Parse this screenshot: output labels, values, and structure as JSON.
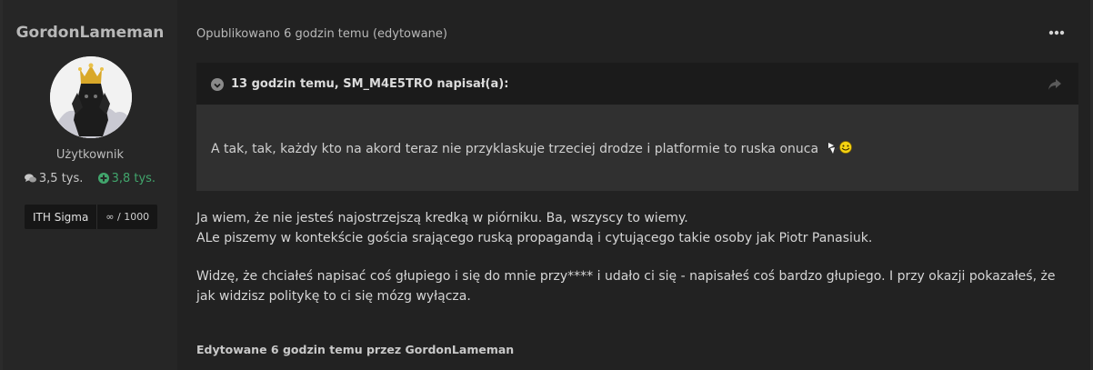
{
  "author": {
    "name": "GordonLameman",
    "rank": "Użytkownik",
    "posts_count": "3,5 tys.",
    "reputation": "3,8 tys.",
    "badge_title": "ITH Sigma",
    "badge_value": "∞ / 1000"
  },
  "post": {
    "meta": "Opublikowano 6 godzin temu (edytowane)",
    "quote": {
      "citation": "13 godzin temu, SM_M4E5TRO napisał(a):",
      "text": "A tak, tak, każdy kto na akord teraz nie przyklaskuje trzeciej drodze i platformie to ruska onuca"
    },
    "paragraphs": [
      {
        "line1": "Ja wiem, że nie jesteś najostrzejszą kredką w piórniku. Ba, wszyscy to wiemy.",
        "line2": "ALe piszemy w kontekście gościa srającego ruską propagandą i cytującego takie osoby jak Piotr Panasiuk."
      },
      {
        "line1": "Widzę, że chciałeś napisać coś głupiego i się do mnie przy**** i udało ci się - napisałeś coś bardzo głupiego. I przy okazji pokazałeś, że jak widzisz politykę to ci się mózg wyłącza."
      }
    ],
    "edited_note": "Edytowane 6 godzin temu przez GordonLameman"
  },
  "icons": {
    "posts": "comments-icon",
    "reputation": "plus-circle-icon",
    "more": "ellipsis-icon",
    "quote_toggle": "chevron-down-circle-icon",
    "share": "share-icon",
    "emote": "emoticon-icon"
  },
  "colors": {
    "background": "#222222",
    "sidebar": "#262626",
    "quote_header": "#1b1b1b",
    "quote_body": "#303030",
    "reputation": "#41a56c"
  }
}
